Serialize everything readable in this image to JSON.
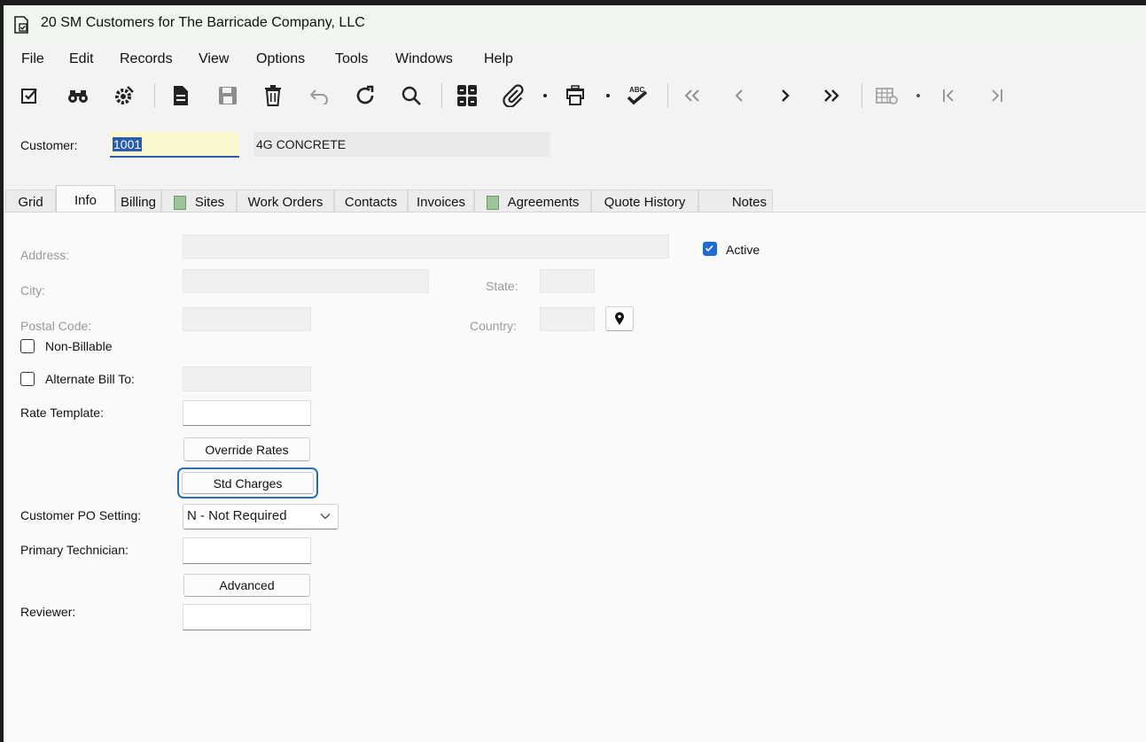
{
  "window": {
    "title": "20 SM Customers for The Barricade Company, LLC"
  },
  "menu": [
    "File",
    "Edit",
    "Records",
    "View",
    "Options",
    "Tools",
    "Windows",
    "Help"
  ],
  "toolbar": {
    "icons": [
      "edit-check-icon",
      "binoculars-icon",
      "settings-gear-icon",
      "new-document-icon",
      "save-icon",
      "delete-icon",
      "undo-icon",
      "refresh-icon",
      "search-icon",
      "grid-layout-icon",
      "attachment-icon",
      "print-icon",
      "spellcheck-icon",
      "first-record-icon",
      "previous-record-icon",
      "next-record-icon",
      "last-record-icon",
      "table-settings-icon",
      "first-page-icon",
      "last-page-icon"
    ]
  },
  "header": {
    "customer_label": "Customer:",
    "customer_id": "1001",
    "customer_name": "4G CONCRETE"
  },
  "tabs": [
    "Grid",
    "Info",
    "Billing",
    "Sites",
    "Work Orders",
    "Contacts",
    "Invoices",
    "Agreements",
    "Quote History",
    "Notes"
  ],
  "active_tab": "Info",
  "info": {
    "address_label": "Address:",
    "city_label": "City:",
    "state_label": "State:",
    "postal_label": "Postal Code:",
    "country_label": "Country:",
    "active_label": "Active",
    "active_checked": true,
    "non_billable_label": "Non-Billable",
    "non_billable_checked": false,
    "alt_bill_label": "Alternate Bill To:",
    "alt_bill_checked": false,
    "rate_template_label": "Rate Template:",
    "override_rates_btn": "Override Rates",
    "std_charges_btn": "Std Charges",
    "po_setting_label": "Customer PO Setting:",
    "po_setting_value": "N - Not Required",
    "primary_tech_label": "Primary Technician:",
    "advanced_btn": "Advanced",
    "reviewer_label": "Reviewer:"
  },
  "colors": {
    "accent": "#1e6bd6",
    "focus": "#2a6fb0",
    "highlight_field": "#fbf7cf",
    "selection": "#2a5db0"
  }
}
